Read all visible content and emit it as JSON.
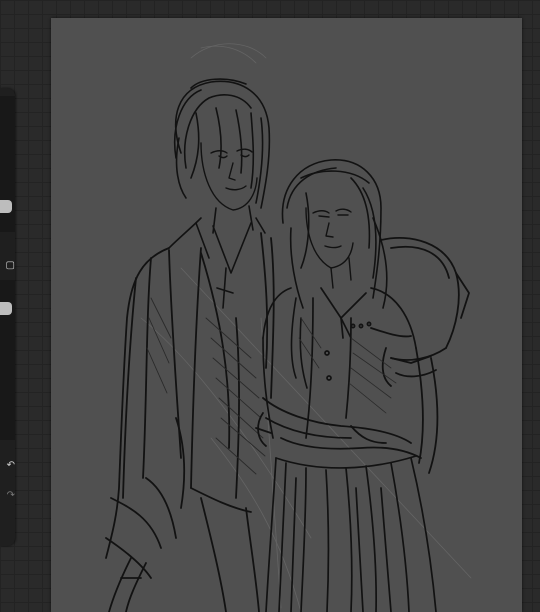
{
  "app": {
    "workspace": "drawing-workspace",
    "canvas_background": "#505050",
    "workspace_background": "#2a2a2a",
    "stroke_color": "#111111"
  },
  "sidebar": {
    "brush_size_level": 0.25,
    "brush_opacity_level": 0.33,
    "buttons": [
      {
        "icon": "square-icon"
      },
      {
        "icon": "undo-icon"
      },
      {
        "icon": "redo-icon"
      }
    ]
  },
  "canvas": {
    "content": "sketch-drawing",
    "subject": "two-figures-sketch"
  }
}
